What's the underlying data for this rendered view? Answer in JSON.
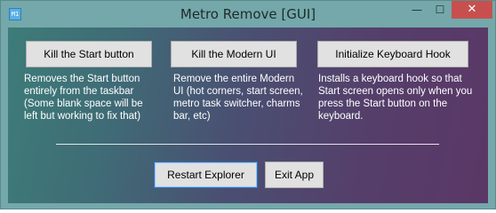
{
  "window": {
    "title": "Metro Remove [GUI]",
    "icon_name": "app-icon",
    "icon_text": "M1",
    "minimize_glyph": "—",
    "maximize_glyph": "☐",
    "close_glyph": "✕"
  },
  "actions": [
    {
      "label": "Kill the Start button",
      "description": "Removes the Start button\nentirely from the taskbar\n(Some blank space will be\nleft but working to fix that)"
    },
    {
      "label": "Kill the Modern UI",
      "description": "Remove the entire Modern\nUI (hot corners, start screen,\nmetro task switcher, charms\nbar, etc)"
    },
    {
      "label": "Initialize Keyboard Hook",
      "description": "Installs a keyboard hook so that\nStart screen opens only when you\npress the Start button on the\nkeyboard."
    }
  ],
  "footer": {
    "restart_label": "Restart Explorer",
    "exit_label": "Exit App"
  },
  "colors": {
    "titlebar": "#74a8aa",
    "close_button": "#c7504f",
    "gradient_left": "#3d7c78",
    "gradient_right": "#5b3766",
    "text": "#ffffff"
  }
}
